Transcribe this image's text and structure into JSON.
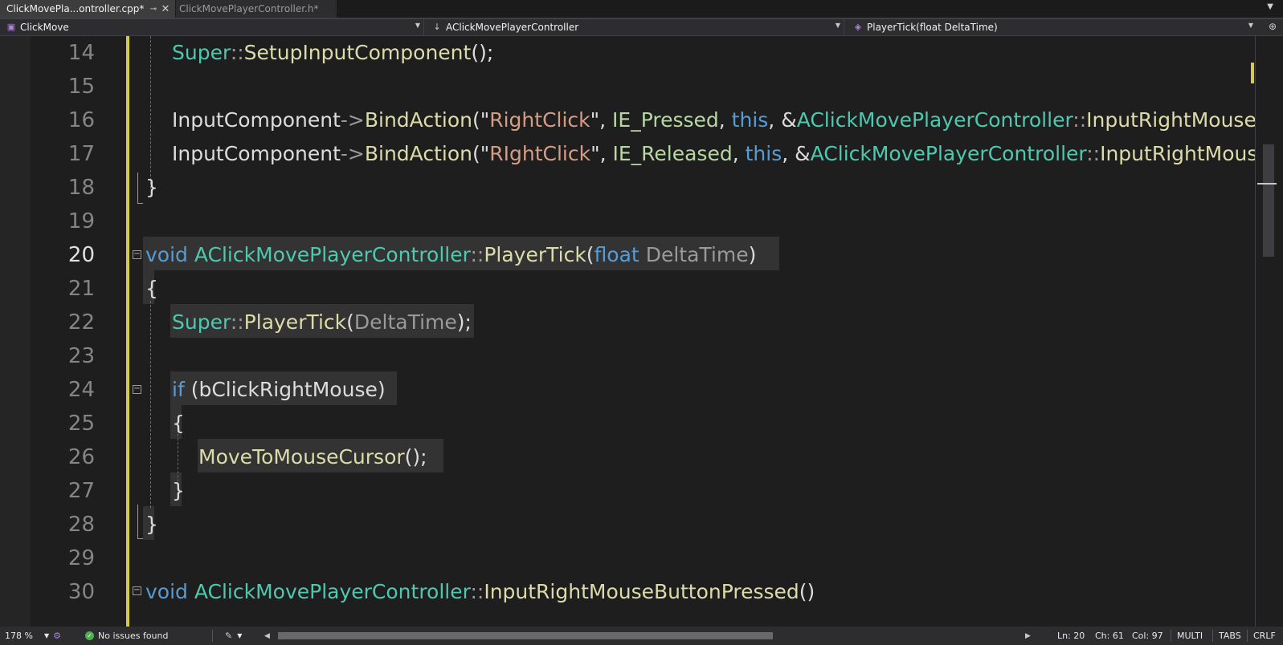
{
  "tabs": [
    {
      "label": "ClickMovePla...ontroller.cpp*",
      "active": true,
      "pin_icon": "pin-icon",
      "close_icon": "close-icon"
    },
    {
      "label": "ClickMovePlayerController.h*",
      "active": false
    }
  ],
  "nav": {
    "project": "ClickMove",
    "class": "AClickMovePlayerController",
    "member": "PlayerTick(float DeltaTime)"
  },
  "editor": {
    "line_numbers": [
      "14",
      "15",
      "16",
      "17",
      "18",
      "19",
      "20",
      "21",
      "22",
      "23",
      "24",
      "25",
      "26",
      "27",
      "28",
      "29",
      "30"
    ],
    "current_line": "20",
    "lines": [
      {
        "n": "14",
        "tokens": [
          {
            "c": "t",
            "v": "Super"
          },
          {
            "c": "g",
            "v": "::"
          },
          {
            "c": "f",
            "v": "SetupInputComponent"
          },
          {
            "c": "",
            "v": "();"
          }
        ]
      },
      {
        "n": "15",
        "tokens": []
      },
      {
        "n": "16",
        "tokens": [
          {
            "c": "",
            "v": "InputComponent"
          },
          {
            "c": "g",
            "v": "->"
          },
          {
            "c": "f",
            "v": "BindAction"
          },
          {
            "c": "",
            "v": "(\""
          },
          {
            "c": "s",
            "v": "RightClick"
          },
          {
            "c": "",
            "v": "\", "
          },
          {
            "c": "e",
            "v": "IE_Pressed"
          },
          {
            "c": "",
            "v": ", "
          },
          {
            "c": "k",
            "v": "this"
          },
          {
            "c": "",
            "v": ", &"
          },
          {
            "c": "t",
            "v": "AClickMovePlayerController"
          },
          {
            "c": "g",
            "v": "::"
          },
          {
            "c": "f",
            "v": "InputRightMouseButtonPressed"
          },
          {
            "c": "",
            "v": ");"
          }
        ]
      },
      {
        "n": "17",
        "tokens": [
          {
            "c": "",
            "v": "InputComponent"
          },
          {
            "c": "g",
            "v": "->"
          },
          {
            "c": "f",
            "v": "BindAction"
          },
          {
            "c": "",
            "v": "(\""
          },
          {
            "c": "s",
            "v": "RIghtClick"
          },
          {
            "c": "",
            "v": "\", "
          },
          {
            "c": "e",
            "v": "IE_Released"
          },
          {
            "c": "",
            "v": ", "
          },
          {
            "c": "k",
            "v": "this"
          },
          {
            "c": "",
            "v": ", &"
          },
          {
            "c": "t",
            "v": "AClickMovePlayerController"
          },
          {
            "c": "g",
            "v": "::"
          },
          {
            "c": "f",
            "v": "InputRightMouseButtonReleased"
          },
          {
            "c": "",
            "v": ");"
          }
        ]
      },
      {
        "n": "18",
        "tokens": [
          {
            "c": "",
            "v": "}"
          }
        ]
      },
      {
        "n": "19",
        "tokens": []
      },
      {
        "n": "20",
        "tokens": [
          {
            "c": "k",
            "v": "void "
          },
          {
            "c": "t",
            "v": "AClickMovePlayerController"
          },
          {
            "c": "g",
            "v": "::"
          },
          {
            "c": "f",
            "v": "PlayerTick"
          },
          {
            "c": "",
            "v": "("
          },
          {
            "c": "k",
            "v": "float "
          },
          {
            "c": "p",
            "v": "DeltaTime"
          },
          {
            "c": "",
            "v": ")"
          }
        ]
      },
      {
        "n": "21",
        "tokens": [
          {
            "c": "",
            "v": "{"
          }
        ]
      },
      {
        "n": "22",
        "tokens": [
          {
            "c": "t",
            "v": "Super"
          },
          {
            "c": "g",
            "v": "::"
          },
          {
            "c": "f",
            "v": "PlayerTick"
          },
          {
            "c": "",
            "v": "("
          },
          {
            "c": "p",
            "v": "DeltaTime"
          },
          {
            "c": "",
            "v": ");"
          }
        ]
      },
      {
        "n": "23",
        "tokens": []
      },
      {
        "n": "24",
        "tokens": [
          {
            "c": "k",
            "v": "if "
          },
          {
            "c": "",
            "v": "(bClickRightMouse)"
          }
        ]
      },
      {
        "n": "25",
        "tokens": [
          {
            "c": "",
            "v": "{"
          }
        ]
      },
      {
        "n": "26",
        "tokens": [
          {
            "c": "f",
            "v": "MoveToMouseCursor"
          },
          {
            "c": "",
            "v": "();"
          }
        ]
      },
      {
        "n": "27",
        "tokens": [
          {
            "c": "",
            "v": "}"
          }
        ]
      },
      {
        "n": "28",
        "tokens": [
          {
            "c": "",
            "v": "}"
          }
        ]
      },
      {
        "n": "29",
        "tokens": []
      },
      {
        "n": "30",
        "tokens": [
          {
            "c": "k",
            "v": "void "
          },
          {
            "c": "t",
            "v": "AClickMovePlayerController"
          },
          {
            "c": "g",
            "v": "::"
          },
          {
            "c": "f",
            "v": "InputRightMouseButtonPressed"
          },
          {
            "c": "",
            "v": "()"
          }
        ]
      }
    ]
  },
  "status": {
    "zoom": "178 %",
    "issues": "No issues found",
    "ln": "Ln: 20",
    "ch": "Ch: 61",
    "col": "Col: 97",
    "multi": "MULTI",
    "tabs": "TABS",
    "eol": "CRLF"
  },
  "colors": {
    "keyword": "#569cd6",
    "type": "#4ec9b0",
    "function": "#dcdcaa",
    "string": "#d69d85",
    "parameter": "#9a9a9a",
    "enum": "#b8d7a3",
    "change_marker": "#d7c94a"
  }
}
